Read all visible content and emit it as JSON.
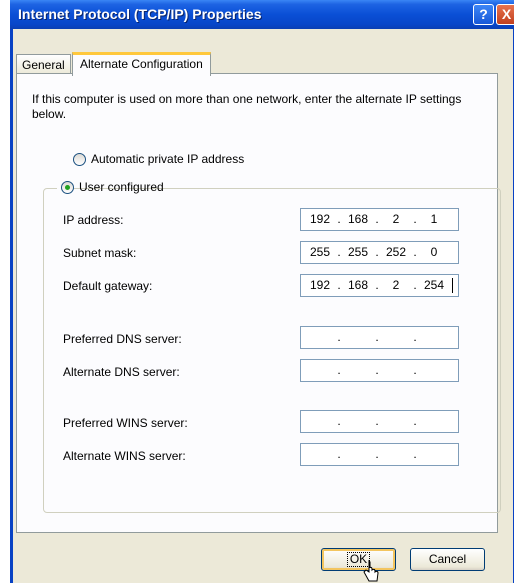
{
  "window": {
    "title": "Internet Protocol (TCP/IP) Properties"
  },
  "titlebar": {
    "help_glyph": "?",
    "close_glyph": "X"
  },
  "tabs": [
    {
      "label": "General",
      "selected": false
    },
    {
      "label": "Alternate Configuration",
      "selected": true
    }
  ],
  "intro": "If this computer is used on more than one network, enter the alternate IP settings below.",
  "radios": {
    "automatic": {
      "label": "Automatic private IP address",
      "checked": false
    },
    "user": {
      "label": "User configured",
      "checked": true
    }
  },
  "fields": {
    "ip_address": {
      "label": "IP address:",
      "octets": [
        "192",
        "168",
        "2",
        "1"
      ]
    },
    "subnet_mask": {
      "label": "Subnet mask:",
      "octets": [
        "255",
        "255",
        "252",
        "0"
      ]
    },
    "default_gateway": {
      "label": "Default gateway:",
      "octets": [
        "192",
        "168",
        "2",
        "254"
      ]
    },
    "preferred_dns": {
      "label": "Preferred DNS server:",
      "octets": [
        "",
        "",
        "",
        ""
      ]
    },
    "alternate_dns": {
      "label": "Alternate DNS server:",
      "octets": [
        "",
        "",
        "",
        ""
      ]
    },
    "preferred_wins": {
      "label": "Preferred WINS server:",
      "octets": [
        "",
        "",
        "",
        ""
      ]
    },
    "alternate_wins": {
      "label": "Alternate WINS server:",
      "octets": [
        "",
        "",
        "",
        ""
      ]
    }
  },
  "ip_separator": ".",
  "buttons": {
    "ok": "OK",
    "cancel": "Cancel"
  },
  "colors": {
    "titlebar": "#0a4fd6",
    "dialog_bg": "#ece9d8",
    "tab_highlight": "#ffc83c"
  }
}
